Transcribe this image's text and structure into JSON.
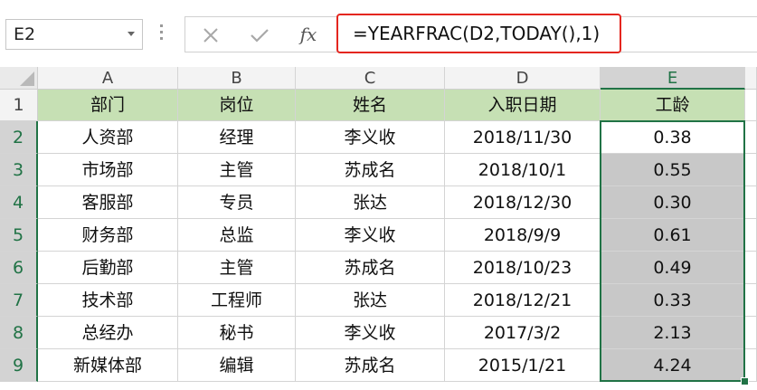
{
  "name_box": {
    "value": "E2"
  },
  "formula_bar": {
    "cancel_icon": "close-icon",
    "enter_icon": "check-icon",
    "function_label": "fx",
    "formula": "=YEARFRAC(D2,TODAY(),1)"
  },
  "columns": [
    "A",
    "B",
    "C",
    "D",
    "E"
  ],
  "rows": [
    "1",
    "2",
    "3",
    "4",
    "5",
    "6",
    "7",
    "8",
    "9"
  ],
  "table": {
    "headers": [
      "部门",
      "岗位",
      "姓名",
      "入职日期",
      "工龄"
    ],
    "rows": [
      [
        "人资部",
        "经理",
        "李义收",
        "2018/11/30",
        "0.38"
      ],
      [
        "市场部",
        "主管",
        "苏成名",
        "2018/10/1",
        "0.55"
      ],
      [
        "客服部",
        "专员",
        "张达",
        "2018/12/30",
        "0.30"
      ],
      [
        "财务部",
        "总监",
        "李义收",
        "2018/9/9",
        "0.61"
      ],
      [
        "后勤部",
        "主管",
        "苏成名",
        "2018/10/23",
        "0.49"
      ],
      [
        "技术部",
        "工程师",
        "张达",
        "2018/12/21",
        "0.33"
      ],
      [
        "总经办",
        "秘书",
        "李义收",
        "2017/3/2",
        "2.13"
      ],
      [
        "新媒体部",
        "编辑",
        "苏成名",
        "2015/1/21",
        "4.24"
      ]
    ]
  },
  "selection": {
    "active_cell": "E2",
    "range": "E2:E9"
  },
  "colors": {
    "header_fill": "#c6e0b4",
    "selection_fill": "#c8c8c8",
    "selection_border": "#217346",
    "formula_highlight": "#e4261f"
  }
}
